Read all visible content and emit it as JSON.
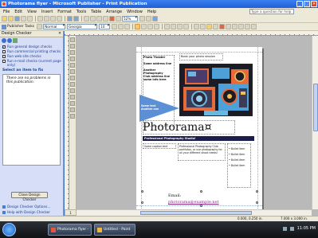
{
  "window": {
    "title": "Photorama flyer - Microsoft Publisher - Print Publication",
    "minimize": "_",
    "maximize": "□",
    "close": "✕"
  },
  "menu": {
    "items": [
      "File",
      "Edit",
      "View",
      "Insert",
      "Format",
      "Tools",
      "Table",
      "Arrange",
      "Window",
      "Help"
    ],
    "help_placeholder": "Type a question for help"
  },
  "toolbar": {
    "zoom": "52%",
    "publisher_tasks": "Publisher Tasks",
    "style": "Normal",
    "font": "Georgia",
    "font_size": "10"
  },
  "task_pane": {
    "title": "Design Checker",
    "close": "✕",
    "options": [
      {
        "label": "Run general design checks",
        "checked": true
      },
      {
        "label": "Run commercial printing checks",
        "checked": false
      },
      {
        "label": "Run web site checks",
        "checked": false
      },
      {
        "label": "Run e-mail checks (current page only)",
        "checked": false
      }
    ],
    "select_label": "Select an item to fix",
    "result": "There are no problems in this publication.",
    "close_button": "Close Design Checker",
    "links": [
      "Design Checker Options...",
      "Help with Design Checker"
    ]
  },
  "flyer": {
    "contact_lines": [
      "Photo Theater",
      "Some address line",
      "Another Photography",
      "Club address line",
      "some info here"
    ],
    "arrow_text": [
      "Some text",
      "Another one"
    ],
    "top_caption": "Book your photo session",
    "title": "Photorama¤",
    "subtitle": "Professional Photography Studio!",
    "mini_caption": "Some caption text",
    "body_text": "Professional Photography Club portfolios, or use photography for all your different shoot needs!",
    "bullets": [
      "Bullet item",
      "Bullet item",
      "Bullet item",
      "Bullet item"
    ],
    "email_label": "Email:",
    "email": "photorama@example.net"
  },
  "page_number": "1",
  "status": {
    "position": "0.000, 0.250 in.",
    "size": "7.000 x 3.000 in."
  },
  "taskbar": {
    "buttons": [
      "Photorama flyer - ...",
      "Untitled - Paint"
    ],
    "clock": "11:05 PM"
  },
  "colors": {
    "accent_blue": "#5b8fd6",
    "subtitle_bar": "#1d1d4d",
    "email_link": "#8a2a8a"
  }
}
